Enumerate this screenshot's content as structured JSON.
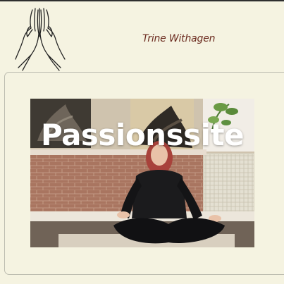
{
  "header": {
    "site_name": "Trine Withagen",
    "logo_icon": "praying-hands-icon"
  },
  "hero": {
    "title": "Passionssite",
    "image": "woman-meditating-photo"
  },
  "colors": {
    "background": "#f5f3e1",
    "site_name": "#6b2b1f",
    "hero_title": "#ffffff"
  }
}
